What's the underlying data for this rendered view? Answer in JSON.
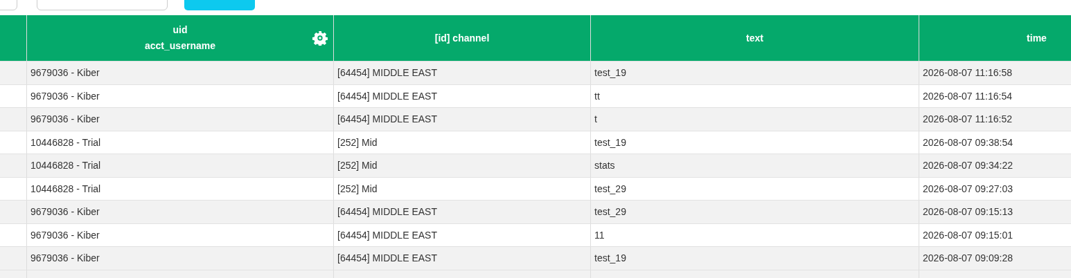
{
  "table": {
    "columns": [
      {},
      {
        "label": "uid",
        "sub": "acct_username"
      },
      {
        "label": "[id] channel"
      },
      {
        "label": "text"
      },
      {
        "label": "time"
      }
    ],
    "rows": [
      {
        "user": "9679036 - Kiber",
        "channel": "[64454] MIDDLE EAST",
        "text": "test_19",
        "time": "2026-08-07 11:16:58"
      },
      {
        "user": "9679036 - Kiber",
        "channel": "[64454] MIDDLE EAST",
        "text": "tt",
        "time": "2026-08-07 11:16:54"
      },
      {
        "user": "9679036 - Kiber",
        "channel": "[64454] MIDDLE EAST",
        "text": "t",
        "time": "2026-08-07 11:16:52"
      },
      {
        "user": "10446828 - Trial",
        "channel": "[252] Mid",
        "text": "test_19",
        "time": "2026-08-07 09:38:54"
      },
      {
        "user": "10446828 - Trial",
        "channel": "[252] Mid",
        "text": "stats",
        "time": "2026-08-07 09:34:22"
      },
      {
        "user": "10446828 - Trial",
        "channel": "[252] Mid",
        "text": "test_29",
        "time": "2026-08-07 09:27:03"
      },
      {
        "user": "9679036 - Kiber",
        "channel": "[64454] MIDDLE EAST",
        "text": "test_29",
        "time": "2026-08-07 09:15:13"
      },
      {
        "user": "9679036 - Kiber",
        "channel": "[64454] MIDDLE EAST",
        "text": "11",
        "time": "2026-08-07 09:15:01"
      },
      {
        "user": "9679036 - Kiber",
        "channel": "[64454] MIDDLE EAST",
        "text": "test_19",
        "time": "2026-08-07 09:09:28"
      }
    ]
  }
}
